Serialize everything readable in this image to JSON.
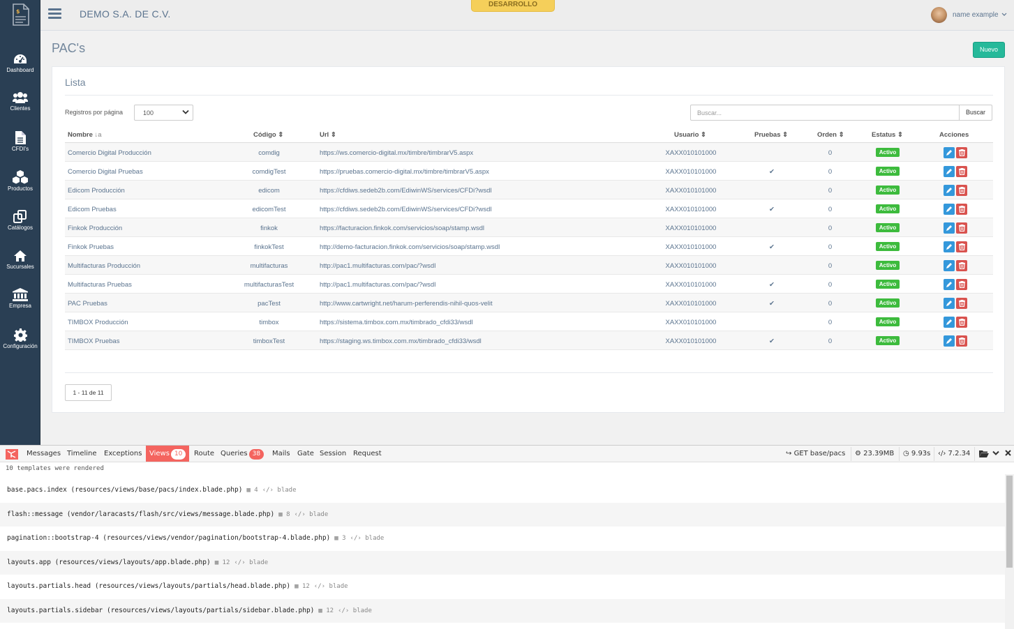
{
  "header": {
    "company": "DEMO S.A. DE C.V.",
    "env_badge": "DESARROLLO",
    "user_name": "name example"
  },
  "sidebar": {
    "items": [
      {
        "label": "Dashboard",
        "icon": "dashboard-icon"
      },
      {
        "label": "Clientes",
        "icon": "users-icon"
      },
      {
        "label": "CFDI's",
        "icon": "file-icon"
      },
      {
        "label": "Productos",
        "icon": "cubes-icon"
      },
      {
        "label": "Catálogos",
        "icon": "clone-icon"
      },
      {
        "label": "Sucursales",
        "icon": "home-icon"
      },
      {
        "label": "Empresa",
        "icon": "bank-icon"
      },
      {
        "label": "Configuración",
        "icon": "gear-icon"
      }
    ]
  },
  "page": {
    "title": "PAC's",
    "new_button": "Nuevo",
    "panel_title": "Lista",
    "per_page_label": "Registros por página",
    "per_page_value": "100",
    "search_placeholder": "Buscar...",
    "search_button": "Buscar",
    "pagination": "1 - 11 de 11"
  },
  "table": {
    "columns": [
      "Nombre",
      "Código",
      "Url",
      "Usuario",
      "Pruebas",
      "Orden",
      "Estatus",
      "Acciones"
    ],
    "rows": [
      {
        "nombre": "Comercio Digital Producción",
        "codigo": "comdig",
        "url": "https://ws.comercio-digital.mx/timbre/timbrarV5.aspx",
        "usuario": "XAXX010101000",
        "pruebas": "",
        "orden": "0",
        "estatus": "Activo"
      },
      {
        "nombre": "Comercio Digital Pruebas",
        "codigo": "comdigTest",
        "url": "https://pruebas.comercio-digital.mx/timbre/timbrarV5.aspx",
        "usuario": "XAXX010101000",
        "pruebas": "✔",
        "orden": "0",
        "estatus": "Activo"
      },
      {
        "nombre": "Edicom Producción",
        "codigo": "edicom",
        "url": "https://cfdiws.sedeb2b.com/EdiwinWS/services/CFDi?wsdl",
        "usuario": "XAXX010101000",
        "pruebas": "",
        "orden": "0",
        "estatus": "Activo"
      },
      {
        "nombre": "Edicom Pruebas",
        "codigo": "edicomTest",
        "url": "https://cfdiws.sedeb2b.com/EdiwinWS/services/CFDi?wsdl",
        "usuario": "XAXX010101000",
        "pruebas": "✔",
        "orden": "0",
        "estatus": "Activo"
      },
      {
        "nombre": "Finkok Producción",
        "codigo": "finkok",
        "url": "https://facturacion.finkok.com/servicios/soap/stamp.wsdl",
        "usuario": "XAXX010101000",
        "pruebas": "",
        "orden": "0",
        "estatus": "Activo"
      },
      {
        "nombre": "Finkok Pruebas",
        "codigo": "finkokTest",
        "url": "http://demo-facturacion.finkok.com/servicios/soap/stamp.wsdl",
        "usuario": "XAXX010101000",
        "pruebas": "✔",
        "orden": "0",
        "estatus": "Activo"
      },
      {
        "nombre": "Multifacturas Producción",
        "codigo": "multifacturas",
        "url": "http://pac1.multifacturas.com/pac/?wsdl",
        "usuario": "XAXX010101000",
        "pruebas": "",
        "orden": "0",
        "estatus": "Activo"
      },
      {
        "nombre": "Multifacturas Pruebas",
        "codigo": "multifacturasTest",
        "url": "http://pac1.multifacturas.com/pac/?wsdl",
        "usuario": "XAXX010101000",
        "pruebas": "✔",
        "orden": "0",
        "estatus": "Activo"
      },
      {
        "nombre": "PAC Pruebas",
        "codigo": "pacTest",
        "url": "http://www.cartwright.net/harum-perferendis-nihil-quos-velit",
        "usuario": "XAXX010101000",
        "pruebas": "✔",
        "orden": "0",
        "estatus": "Activo"
      },
      {
        "nombre": "TIMBOX Producción",
        "codigo": "timbox",
        "url": "https://sistema.timbox.com.mx/timbrado_cfdi33/wsdl",
        "usuario": "XAXX010101000",
        "pruebas": "",
        "orden": "0",
        "estatus": "Activo"
      },
      {
        "nombre": "TIMBOX Pruebas",
        "codigo": "timboxTest",
        "url": "https://staging.ws.timbox.com.mx/timbrado_cfdi33/wsdl",
        "usuario": "XAXX010101000",
        "pruebas": "✔",
        "orden": "0",
        "estatus": "Activo"
      }
    ]
  },
  "debugbar": {
    "tabs": [
      {
        "label": "Messages",
        "count": ""
      },
      {
        "label": "Timeline",
        "count": ""
      },
      {
        "label": "Exceptions",
        "count": ""
      },
      {
        "label": "Views",
        "count": "10"
      },
      {
        "label": "Route",
        "count": ""
      },
      {
        "label": "Queries",
        "count": "38"
      },
      {
        "label": "Mails",
        "count": ""
      },
      {
        "label": "Gate",
        "count": ""
      },
      {
        "label": "Session",
        "count": ""
      },
      {
        "label": "Request",
        "count": ""
      }
    ],
    "route": "GET base/pacs",
    "memory": "23.39MB",
    "time": "9.93s",
    "php": "7.2.34",
    "status": "10 templates were rendered",
    "templates": [
      {
        "name": "base.pacs.index (resources/views/base/pacs/index.blade.php)",
        "params": "4",
        "type": "blade"
      },
      {
        "name": "flash::message (vendor/laracasts/flash/src/views/message.blade.php)",
        "params": "8",
        "type": "blade"
      },
      {
        "name": "pagination::bootstrap-4 (resources/views/vendor/pagination/bootstrap-4.blade.php)",
        "params": "3",
        "type": "blade"
      },
      {
        "name": "layouts.app (resources/views/layouts/app.blade.php)",
        "params": "12",
        "type": "blade"
      },
      {
        "name": "layouts.partials.head (resources/views/layouts/partials/head.blade.php)",
        "params": "12",
        "type": "blade"
      },
      {
        "name": "layouts.partials.sidebar (resources/views/layouts/partials/sidebar.blade.php)",
        "params": "12",
        "type": "blade"
      }
    ]
  },
  "colors": {
    "sidebar": "#2a3f54",
    "primary": "#26b99a",
    "active_badge": "#3dbb3d",
    "edit": "#3498db",
    "delete": "#d9534f",
    "debug_accent": "#f4645f",
    "env_badge": "#f5cf5a"
  }
}
